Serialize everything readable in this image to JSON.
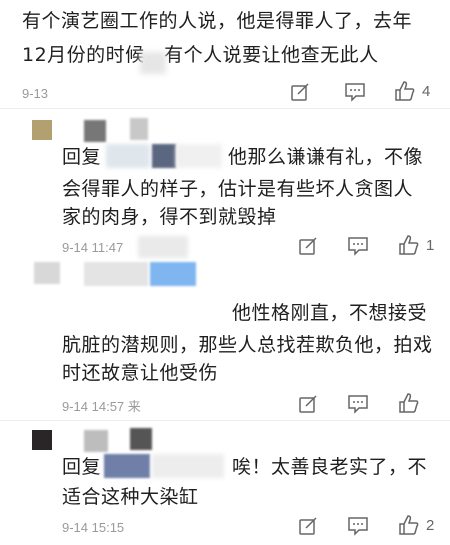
{
  "comments": [
    {
      "line1": "有个演艺圈工作的人说，他是得罪人了，去年",
      "line2": "12月份的时候，有个人说要让他查无此人",
      "date": "9-13",
      "likes": "4"
    },
    {
      "prefix": "回复",
      "line1": "他那么谦谦有礼，不像",
      "line2": "会得罪人的样子，估计是有些坏人贪图人",
      "line3": "家的肉身，得不到就毁掉",
      "date": "9-14 11:47",
      "likes": "1"
    },
    {
      "line1": "他性格刚直，不想接受",
      "line2": "肮脏的潜规则，那些人总找茬欺负他，拍戏",
      "line3": "时还故意让他受伤",
      "date": "9-14 14:57 来",
      "likes": ""
    },
    {
      "prefix": "回复",
      "line1": "唉！太善良老实了，不",
      "line2": "适合这种大染缸",
      "date": "9-14 15:15",
      "likes": "2"
    }
  ],
  "icons": [
    "edit-icon",
    "comment-icon",
    "thumbs-up-icon"
  ]
}
